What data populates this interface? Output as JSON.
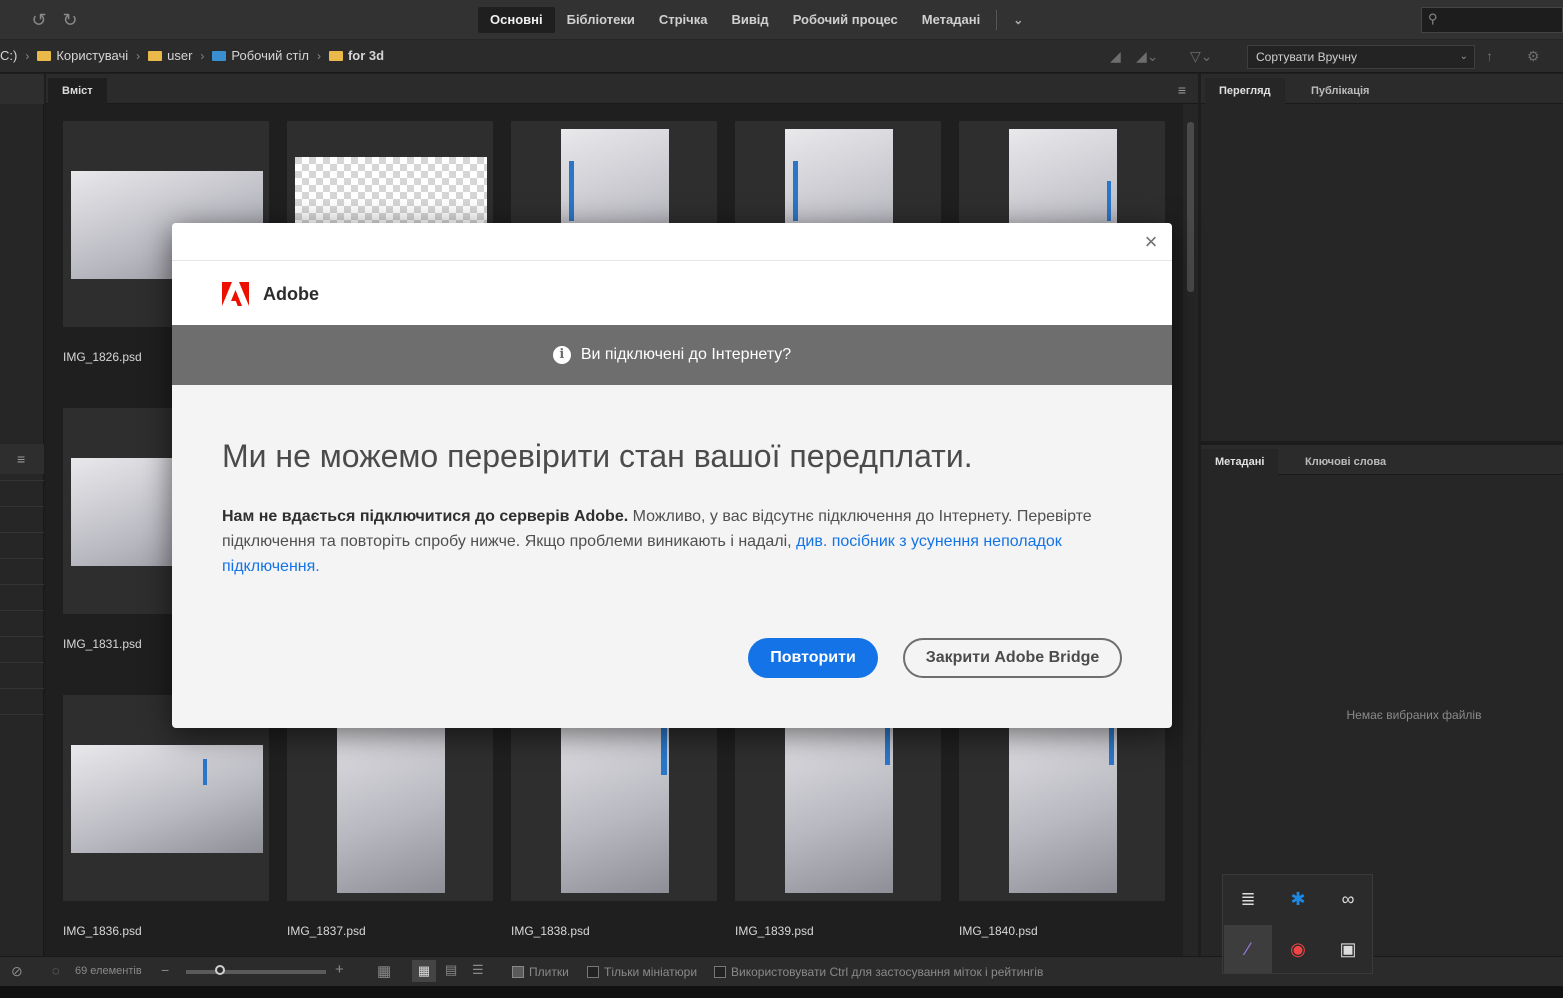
{
  "workspaces": [
    "Основні",
    "Бібліотеки",
    "Стрічка",
    "Вивід",
    "Робочий процес",
    "Метадані"
  ],
  "path": {
    "drive": "C:)",
    "crumbs": [
      "Користувачі",
      "user",
      "Робочий стіл",
      "for 3d"
    ]
  },
  "sort": {
    "label": "Сортувати Вручну"
  },
  "content": {
    "tab_label": "Вміст",
    "files": [
      "IMG_1826.psd",
      "IMG_1831.psd",
      "IMG_1836.psd",
      "IMG_1837.psd",
      "IMG_1838.psd",
      "IMG_1839.psd",
      "IMG_1840.psd"
    ]
  },
  "right_panel": {
    "preview_tab": "Перегляд",
    "publish_tab": "Публікація",
    "metadata_tab": "Метадані",
    "keywords_tab": "Ключові слова",
    "no_files": "Немає вибраних файлів"
  },
  "status": {
    "count": "69 елементів",
    "tiles": "Плитки",
    "thumbs_only": "Тільки мініатюри",
    "ctrl_hint": "Використовувати Ctrl для застосування міток і рейтингів"
  },
  "dialog": {
    "brand": "Adobe",
    "notice": "Ви підключені до Інтернету?",
    "heading": "Ми не можемо перевірити стан вашої передплати.",
    "body_bold": "Нам не вдається підключитися до серверів Adobe.",
    "body_text": " Можливо, у вас відсутнє підключення до Інтернету. Перевірте підключення та повторіть спробу нижче. Якщо проблеми виникають і надалі, ",
    "body_link": "див. посібник з усунення неполадок підключення.",
    "retry_label": "Повторити",
    "close_bridge_label": "Закрити Adobe Bridge"
  },
  "colors": {
    "accent": "#1473e6",
    "notice_bar": "#6e6e6e"
  }
}
